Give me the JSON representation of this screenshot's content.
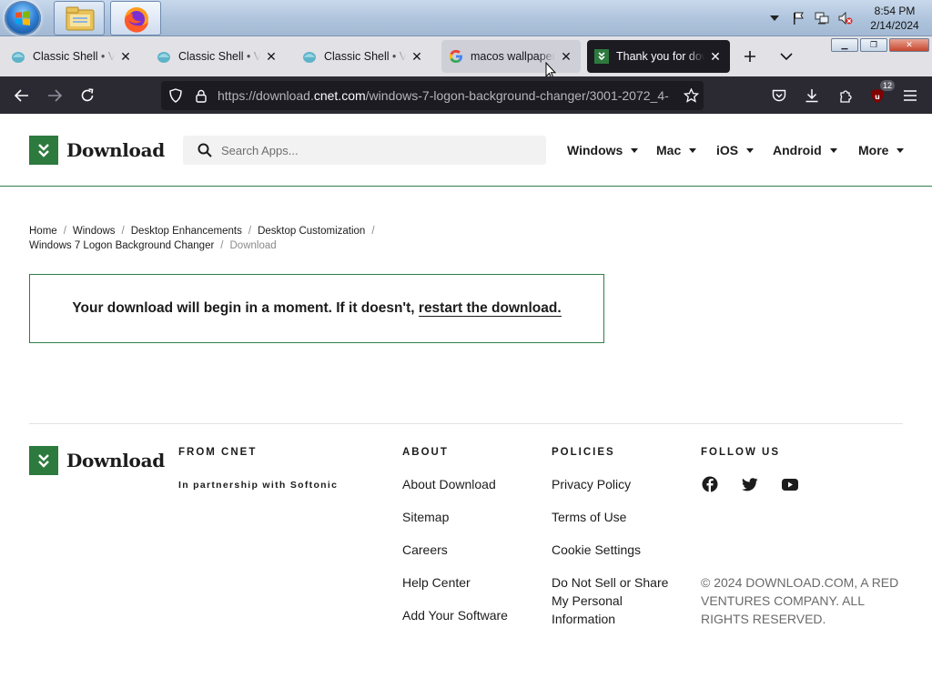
{
  "taskbar": {
    "clock_time": "8:54 PM",
    "clock_date": "2/14/2024",
    "icons": [
      "start-orb-icon",
      "file-explorer-icon",
      "firefox-icon",
      "show-hidden-icons-icon",
      "action-center-flag-icon",
      "network-icon",
      "volume-muted-icon"
    ]
  },
  "tabs": [
    {
      "title": "Classic Shell • View",
      "favicon": "classic-shell-icon"
    },
    {
      "title": "Classic Shell • View",
      "favicon": "classic-shell-icon"
    },
    {
      "title": "Classic Shell • View",
      "favicon": "classic-shell-icon"
    },
    {
      "title": "macos wallpaper -",
      "favicon": "google-icon"
    },
    {
      "title": "Thank you for downloading",
      "favicon": "download-site-icon"
    }
  ],
  "navbar": {
    "url_prefix": "https://download.",
    "url_domain": "cnet.com",
    "url_path": "/windows-7-logon-background-changer/3001-2072_4-",
    "extension_badge": "12"
  },
  "site": {
    "logo_text": "Download",
    "search_placeholder": "Search Apps...",
    "menu": [
      "Windows",
      "Mac",
      "iOS",
      "Android",
      "More"
    ]
  },
  "breadcrumb": {
    "items": [
      "Home",
      "Windows",
      "Desktop Enhancements",
      "Desktop Customization",
      "Windows 7 Logon Background Changer"
    ],
    "current": "Download"
  },
  "message": {
    "text": "Your download will begin in a moment. If it doesn't, ",
    "link": "restart the download."
  },
  "footer": {
    "logo_text": "Download",
    "from_cnet_heading": "FROM CNET",
    "partnership": "In partnership with Softonic",
    "about_heading": "ABOUT",
    "about_links": [
      "About Download",
      "Sitemap",
      "Careers",
      "Help Center",
      "Add Your Software"
    ],
    "policies_heading": "POLICIES",
    "policies_links": [
      "Privacy Policy",
      "Terms of Use",
      "Cookie Settings"
    ],
    "policies_multiline": [
      "Do Not Sell or Share",
      "My Personal",
      "Information"
    ],
    "follow_heading": "FOLLOW US",
    "social": [
      "facebook-icon",
      "twitter-icon",
      "youtube-icon"
    ],
    "copyright": "© 2024 DOWNLOAD.COM, A RED VENTURES COMPANY. ALL RIGHTS RESERVED."
  },
  "colors": {
    "brand_green": "#2d7a3e",
    "tab_selected": "#1c1b22",
    "navbar": "#2b2a33"
  }
}
